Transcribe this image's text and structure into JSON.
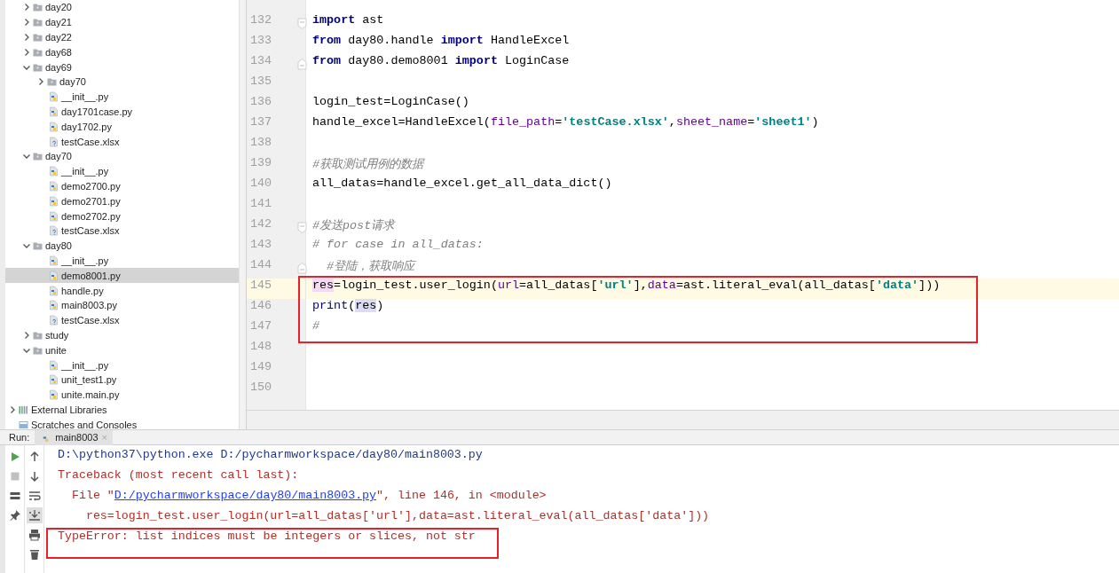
{
  "project_tree": {
    "items": [
      {
        "label": "day20",
        "kind": "folder",
        "expanded": false,
        "selected": false
      },
      {
        "label": "day21",
        "kind": "folder",
        "expanded": false,
        "selected": false
      },
      {
        "label": "day22",
        "kind": "folder",
        "expanded": false,
        "selected": false
      },
      {
        "label": "day68",
        "kind": "folder",
        "expanded": false,
        "selected": false
      },
      {
        "label": "day69",
        "kind": "folder",
        "expanded": true,
        "selected": false,
        "children": [
          {
            "label": "day70",
            "kind": "folder",
            "expanded": false,
            "selected": false
          },
          {
            "label": "__init__.py",
            "kind": "python",
            "selected": false
          },
          {
            "label": "day1701case.py",
            "kind": "python",
            "selected": false
          },
          {
            "label": "day1702.py",
            "kind": "python",
            "selected": false
          },
          {
            "label": "testCase.xlsx",
            "kind": "excel",
            "selected": false
          }
        ]
      },
      {
        "label": "day70",
        "kind": "folder",
        "expanded": true,
        "selected": false,
        "children": [
          {
            "label": "__init__.py",
            "kind": "python",
            "selected": false
          },
          {
            "label": "demo2700.py",
            "kind": "python",
            "selected": false
          },
          {
            "label": "demo2701.py",
            "kind": "python",
            "selected": false
          },
          {
            "label": "demo2702.py",
            "kind": "python",
            "selected": false
          },
          {
            "label": "testCase.xlsx",
            "kind": "excel",
            "selected": false
          }
        ]
      },
      {
        "label": "day80",
        "kind": "folder",
        "expanded": true,
        "selected": false,
        "children": [
          {
            "label": "__init__.py",
            "kind": "python",
            "selected": false
          },
          {
            "label": "demo8001.py",
            "kind": "python",
            "selected": true
          },
          {
            "label": "handle.py",
            "kind": "python",
            "selected": false
          },
          {
            "label": "main8003.py",
            "kind": "python",
            "selected": false
          },
          {
            "label": "testCase.xlsx",
            "kind": "excel",
            "selected": false
          }
        ]
      },
      {
        "label": "study",
        "kind": "folder",
        "expanded": false,
        "selected": false
      },
      {
        "label": "unite",
        "kind": "folder",
        "expanded": true,
        "selected": false,
        "children": [
          {
            "label": "__init__.py",
            "kind": "python",
            "selected": false
          },
          {
            "label": "unit_test1.py",
            "kind": "python",
            "selected": false
          },
          {
            "label": "unite.main.py",
            "kind": "python",
            "selected": false
          }
        ]
      },
      {
        "label": "External Libraries",
        "kind": "library",
        "expanded": false,
        "selected": false
      },
      {
        "label": "Scratches and Consoles",
        "kind": "scratches",
        "selected": false
      }
    ]
  },
  "editor": {
    "lines": [
      {
        "number": "132",
        "fold_start": true,
        "tokens": [
          {
            "kind": "kw",
            "text": "import"
          },
          {
            "kind": "plain",
            "text": " ast"
          }
        ]
      },
      {
        "number": "133",
        "tokens": [
          {
            "kind": "kw",
            "text": "from"
          },
          {
            "kind": "plain",
            "text": " day80.handle "
          },
          {
            "kind": "kw",
            "text": "import"
          },
          {
            "kind": "plain",
            "text": " HandleExcel"
          }
        ]
      },
      {
        "number": "134",
        "fold_end": true,
        "tokens": [
          {
            "kind": "kw",
            "text": "from"
          },
          {
            "kind": "plain",
            "text": " day80.demo8001 "
          },
          {
            "kind": "kw",
            "text": "import"
          },
          {
            "kind": "plain",
            "text": " LoginCase"
          }
        ]
      },
      {
        "number": "135"
      },
      {
        "number": "136",
        "tokens": [
          {
            "kind": "plain",
            "text": "login_test=LoginCase()"
          }
        ]
      },
      {
        "number": "137",
        "tokens": [
          {
            "kind": "plain",
            "text": "handle_excel=HandleExcel("
          },
          {
            "kind": "param",
            "text": "file_path"
          },
          {
            "kind": "plain",
            "text": "="
          },
          {
            "kind": "str",
            "text": "'testCase.xlsx'"
          },
          {
            "kind": "plain",
            "text": ","
          },
          {
            "kind": "param",
            "text": "sheet_name"
          },
          {
            "kind": "plain",
            "text": "="
          },
          {
            "kind": "str",
            "text": "'sheet1'"
          },
          {
            "kind": "plain",
            "text": ")"
          }
        ]
      },
      {
        "number": "138"
      },
      {
        "number": "139",
        "tokens": [
          {
            "kind": "comment",
            "text": "#获取测试用例的数据"
          }
        ]
      },
      {
        "number": "140",
        "tokens": [
          {
            "kind": "plain",
            "text": "all_datas=handle_excel.get_all_data_dict()"
          }
        ]
      },
      {
        "number": "141"
      },
      {
        "number": "142",
        "fold_start": true,
        "tokens": [
          {
            "kind": "comment",
            "text": "#发送post请求"
          }
        ]
      },
      {
        "number": "143",
        "tokens": [
          {
            "kind": "comment",
            "text": "# for case in all_datas:"
          }
        ]
      },
      {
        "number": "144",
        "fold_end": true,
        "tokens": [
          {
            "kind": "comment",
            "text": "  #登陆，获取响应"
          }
        ]
      },
      {
        "number": "145",
        "current": true,
        "boxed": true,
        "tokens": [
          {
            "kind": "write",
            "text": "res"
          },
          {
            "kind": "plain",
            "text": "=login_test.user_login("
          },
          {
            "kind": "param",
            "text": "url"
          },
          {
            "kind": "plain",
            "text": "=all_datas["
          },
          {
            "kind": "str",
            "text": "'url'"
          },
          {
            "kind": "plain",
            "text": "],"
          },
          {
            "kind": "param",
            "text": "data"
          },
          {
            "kind": "plain",
            "text": "=ast.literal_eval(all_datas["
          },
          {
            "kind": "str",
            "text": "'data'"
          },
          {
            "kind": "plain",
            "text": "]))"
          }
        ]
      },
      {
        "number": "146",
        "boxed": true,
        "tokens": [
          {
            "kind": "builtin",
            "text": "print"
          },
          {
            "kind": "plain",
            "text": "("
          },
          {
            "kind": "read",
            "text": "res"
          },
          {
            "kind": "plain",
            "text": ")"
          }
        ]
      },
      {
        "number": "147",
        "boxed": true,
        "tokens": [
          {
            "kind": "comment",
            "text": "#"
          }
        ]
      },
      {
        "number": "148"
      },
      {
        "number": "149"
      },
      {
        "number": "150"
      }
    ]
  },
  "run_panel": {
    "label": "Run:",
    "tabs": [
      {
        "label": "main8003",
        "close": "×",
        "selected": true
      }
    ],
    "console": [
      {
        "kind": "command",
        "segments": [
          {
            "text": "D:\\python37\\python.exe D:/pycharmworkspace/day80/main8003.py"
          }
        ]
      },
      {
        "kind": "error",
        "segments": [
          {
            "text": "Traceback (most recent call last):"
          }
        ]
      },
      {
        "kind": "frame",
        "segments": [
          {
            "text": "File \""
          },
          {
            "text": "D:/pycharmworkspace/day80/main8003.py",
            "link": true
          },
          {
            "text": "\", line 146, in <module>"
          }
        ]
      },
      {
        "kind": "source",
        "segments": [
          {
            "text": "res=login_test.user_login(url=all_datas['url'],data=ast.literal_eval(all_datas['data']))"
          }
        ]
      },
      {
        "kind": "error",
        "boxed": true,
        "segments": [
          {
            "text": "TypeError: list indices must be integers or slices, not str"
          }
        ]
      }
    ]
  }
}
